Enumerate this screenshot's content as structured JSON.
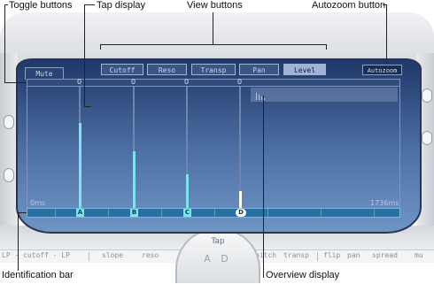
{
  "callouts": {
    "toggle_buttons": "Toggle buttons",
    "tap_display": "Tap display",
    "view_buttons": "View buttons",
    "autozoom_button": "Autozoom button",
    "identification_bar": "Identification bar",
    "overview_display": "Overview display"
  },
  "view_buttons": [
    {
      "label": "Cutoff",
      "active": false
    },
    {
      "label": "Reso",
      "active": false
    },
    {
      "label": "Transp",
      "active": false
    },
    {
      "label": "Pan",
      "active": false
    },
    {
      "label": "Level",
      "active": true
    }
  ],
  "mute_label": "Mute",
  "autozoom_label": "Autozoom",
  "toggle_values": [
    "0",
    "0",
    "0",
    "0"
  ],
  "time_start": "0ms",
  "time_end": "1736ms",
  "taps": [
    {
      "id": "A",
      "level": 0.7,
      "color": "#7fe3ea"
    },
    {
      "id": "B",
      "level": 0.47,
      "color": "#7fe3ea"
    },
    {
      "id": "C",
      "level": 0.28,
      "color": "#7fe3ea"
    },
    {
      "id": "D",
      "level": 0.14,
      "color": "#ffffff"
    }
  ],
  "params": [
    "LP - cutoff - LP",
    "slope",
    "reso",
    "pitch",
    "transp",
    "flip",
    "pan",
    "spread",
    "mu"
  ],
  "tap_dial": {
    "label": "Tap",
    "value": "A D"
  },
  "colors": {
    "screen_top": "#20386a",
    "screen_bottom": "#6f95c4",
    "tap_bar": "#7fe3ea",
    "id_bar": "#2a6fa1"
  }
}
